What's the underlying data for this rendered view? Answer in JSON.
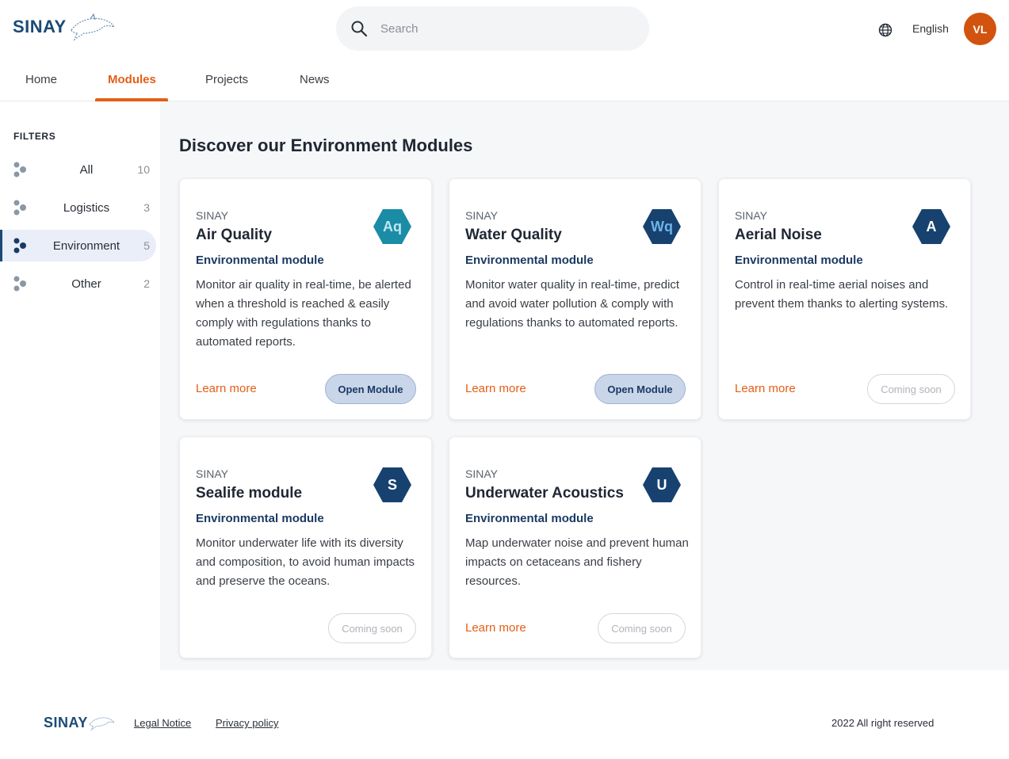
{
  "header": {
    "brand": "SINAY",
    "search_placeholder": "Search",
    "language": "English",
    "avatar_initials": "VL"
  },
  "nav": {
    "tabs": [
      {
        "label": "Home",
        "active": false
      },
      {
        "label": "Modules",
        "active": true
      },
      {
        "label": "Projects",
        "active": false
      },
      {
        "label": "News",
        "active": false
      }
    ]
  },
  "sidebar": {
    "title": "FILTERS",
    "filters": [
      {
        "label": "All",
        "count": "10",
        "active": false
      },
      {
        "label": "Logistics",
        "count": "3",
        "active": false
      },
      {
        "label": "Environment",
        "count": "5",
        "active": true
      },
      {
        "label": "Other",
        "count": "2",
        "active": false
      }
    ]
  },
  "main": {
    "title": "Discover our Environment Modules",
    "cards": [
      {
        "brand": "SINAY",
        "title": "Air Quality",
        "type": "Environmental module",
        "description": "Monitor air quality in real-time, be alerted when a threshold is reached & easily comply with regulations thanks to automated reports.",
        "icon_label": "Aq",
        "icon_color": "#1b8ca6",
        "icon_text_color": "#bfe6f0",
        "learn_more": "Learn more",
        "action": "Open Module",
        "action_enabled": true
      },
      {
        "brand": "SINAY",
        "title": "Water Quality",
        "type": "Environmental module",
        "description": "Monitor water quality in real-time, predict and avoid water pollution & comply with regulations thanks to automated reports.",
        "icon_label": "Wq",
        "icon_color": "#17426f",
        "icon_text_color": "#6fb4ea",
        "learn_more": "Learn more",
        "action": "Open Module",
        "action_enabled": true
      },
      {
        "brand": "SINAY",
        "title": "Aerial Noise",
        "type": "Environmental module",
        "description": "Control in real-time aerial noises and prevent them thanks to alerting systems.",
        "icon_label": "A",
        "icon_color": "#17426f",
        "icon_text_color": "#ffffff",
        "learn_more": "Learn more",
        "action": "Coming soon",
        "action_enabled": false
      },
      {
        "brand": "SINAY",
        "title": "Sealife module",
        "type": "Environmental module",
        "description": "Monitor underwater life with its diversity and composition, to avoid human impacts and preserve the oceans.",
        "icon_label": "S",
        "icon_color": "#17426f",
        "icon_text_color": "#ffffff",
        "learn_more": "",
        "action": "Coming soon",
        "action_enabled": false
      },
      {
        "brand": "SINAY",
        "title": "Underwater Acoustics",
        "type": "Environmental module",
        "description": "Map underwater noise and prevent human impacts on cetaceans and fishery resources.",
        "icon_label": "U",
        "icon_color": "#17426f",
        "icon_text_color": "#ffffff",
        "learn_more": "Learn more",
        "action": "Coming soon",
        "action_enabled": false
      }
    ]
  },
  "footer": {
    "brand": "SINAY",
    "legal_notice": "Legal Notice",
    "privacy_policy": "Privacy policy",
    "copyright": "2022 All right reserved"
  },
  "colors": {
    "accent": "#e35f16",
    "brand": "#1b4a77",
    "avatar": "#d2530e"
  },
  "icons": [
    "search-icon",
    "globe-icon",
    "dolphin-logo-icon",
    "filter-dots-icon",
    "hexagon-icon"
  ]
}
